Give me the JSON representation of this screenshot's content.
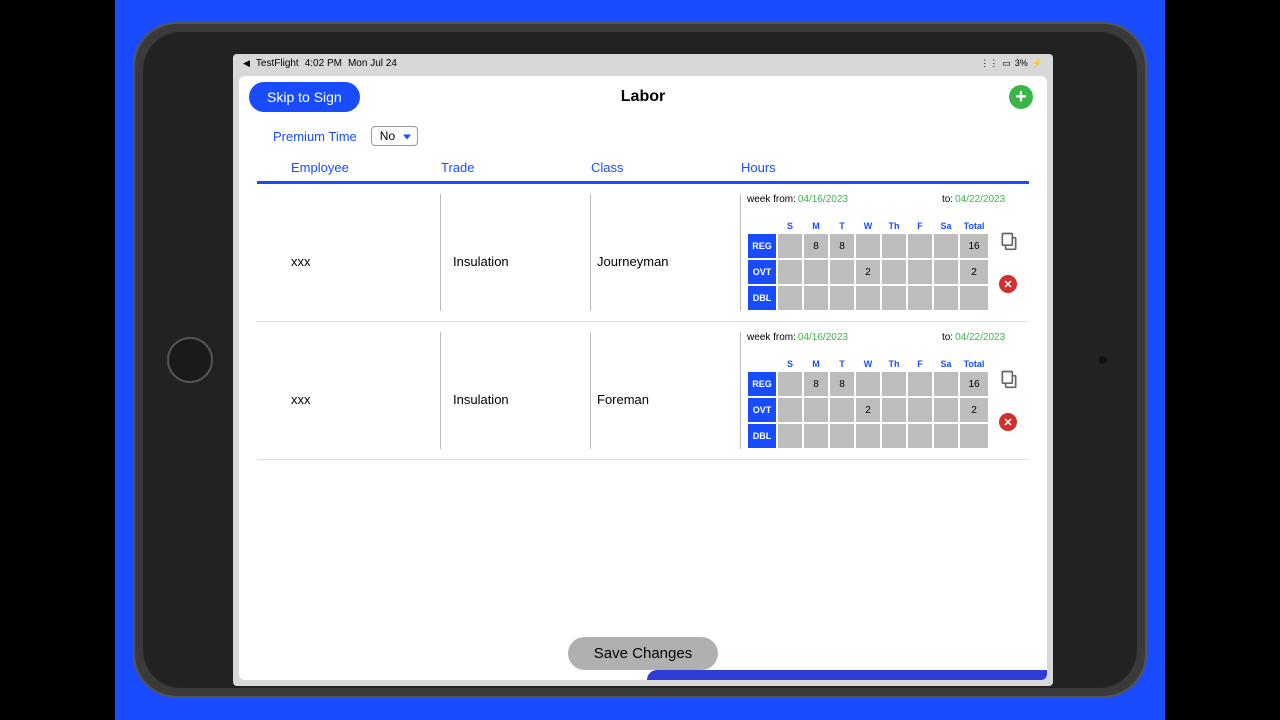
{
  "status_bar": {
    "back_app": "TestFlight",
    "time": "4:02 PM",
    "date": "Mon Jul 24",
    "battery_pct": "3%"
  },
  "header": {
    "skip_label": "Skip to Sign",
    "title": "Labor"
  },
  "premium": {
    "label": "Premium Time",
    "value": "No"
  },
  "columns": {
    "employee": "Employee",
    "trade": "Trade",
    "class": "Class",
    "hours": "Hours"
  },
  "week": {
    "from_label": "week from:",
    "to_label": "to:",
    "from_date": "04/16/2023",
    "to_date": "04/22/2023"
  },
  "days": [
    "S",
    "M",
    "T",
    "W",
    "Th",
    "F",
    "Sa",
    "Total"
  ],
  "row_types": [
    "REG",
    "OVT",
    "DBL"
  ],
  "rows": [
    {
      "employee": "xxx",
      "trade": "Insulation",
      "class": "Journeyman",
      "hours": {
        "REG": [
          "",
          "8",
          "8",
          "",
          "",
          "",
          "",
          "16"
        ],
        "OVT": [
          "",
          "",
          "",
          "2",
          "",
          "",
          "",
          "2"
        ],
        "DBL": [
          "",
          "",
          "",
          "",
          "",
          "",
          "",
          ""
        ]
      }
    },
    {
      "employee": "xxx",
      "trade": "Insulation",
      "class": "Foreman",
      "hours": {
        "REG": [
          "",
          "8",
          "8",
          "",
          "",
          "",
          "",
          "16"
        ],
        "OVT": [
          "",
          "",
          "",
          "2",
          "",
          "",
          "",
          "2"
        ],
        "DBL": [
          "",
          "",
          "",
          "",
          "",
          "",
          "",
          ""
        ]
      }
    }
  ],
  "footer": {
    "save_label": "Save Changes"
  }
}
